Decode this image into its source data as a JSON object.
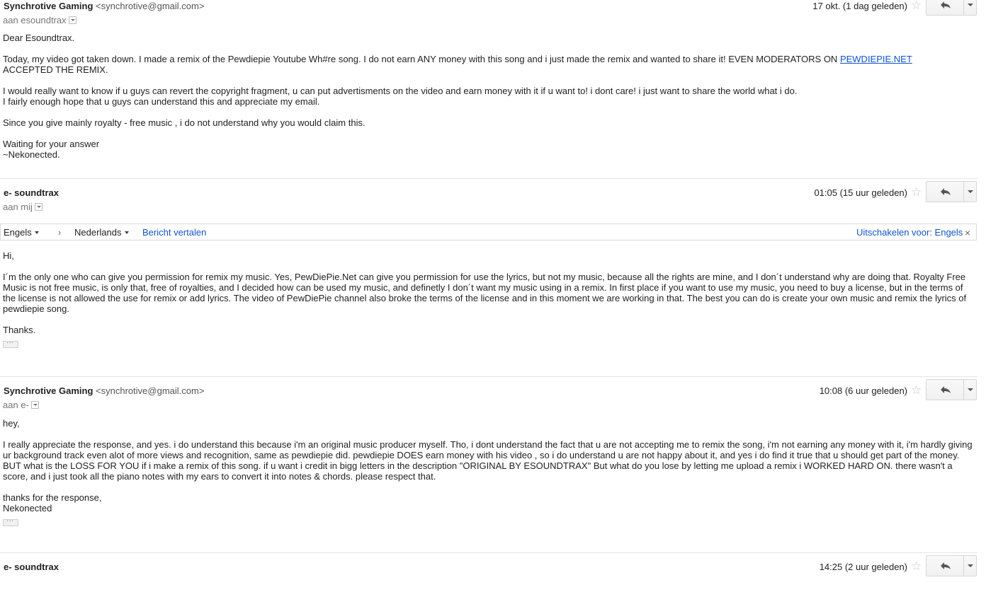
{
  "messages": [
    {
      "sender_name": "Synchrotive Gaming",
      "sender_email": "<synchrotive@gmail.com>",
      "to": "aan esoundtrax",
      "date": "17 okt. (1 dag geleden)",
      "paragraphs": [
        [
          "Dear Esoundtrax."
        ],
        [
          "Today, my video got taken down. I made a remix of the Pewdiepie Youtube Wh#re song. I do not earn ANY money with this song and i just made the remix and wanted to share it! EVEN MODERATORS ON "
        ],
        [
          "I would really want to know if u guys can revert the copyright fragment, u can put advertisments on the video and earn money with it if u want to! i dont care! i just want to share the world what i do.",
          "I fairly enough hope that u guys can understand this and appreciate my email."
        ],
        [
          "Since you give mainly royalty - free music , i do not understand why you would claim this."
        ],
        [
          "Waiting for your answer",
          "~Nekonected."
        ]
      ],
      "link_text": "PEWDIEPIE.NET",
      "after_link": "ACCEPTED THE REMIX."
    },
    {
      "sender_name": "e- soundtrax",
      "to": "aan mij",
      "date": "01:05 (15 uur geleden)",
      "paragraphs": [
        [
          "Hi,"
        ],
        [
          "I´m the only one who can give you permission for remix my music. Yes, PewDiePie.Net can give you permission for use the lyrics, but not my music, because all the rights are mine, and I don´t understand why are doing that. Royalty Free Music is not free music, is only that, free of royalties,  and I decided how can be used my music, and definetly I don´t want my music using in a remix. In first place if you want to use my music, you need to buy a license, but in the terms of the license is not allowed the use for remix or add lyrics. The video of PewDiePie channel also broke the terms of the license and in this moment we are working in that. The best you can do is create your own music and remix the lyrics of pewdiepie song."
        ],
        [
          "Thanks."
        ]
      ]
    },
    {
      "sender_name": "Synchrotive Gaming",
      "sender_email": "<synchrotive@gmail.com>",
      "to": "aan e-",
      "date": "10:08 (6 uur geleden)",
      "paragraphs": [
        [
          "hey,"
        ],
        [
          "I really appreciate the response, and yes. i do understand this because i'm an original music producer myself. Tho, i dont understand the fact that u are not accepting me to remix the song, i'm not earning any money with it, i'm hardly giving ur background track even alot of more views and recognition, same as pewdiepie did. pewdiepie DOES earn money with his video , so i do understand u are not happy about it, and yes i do find it true that u should get part of the money. BUT what is the LOSS FOR YOU if i make a remix of this song. if u want i credit in bigg letters in the description \"ORIGINAL BY ESOUNDTRAX\" But what do you lose by letting me upload a remix i WORKED HARD ON. there wasn't a score, and i just took all the piano notes with my ears to convert it into notes & chords. please respect that."
        ],
        [
          "thanks for the response,",
          "Nekonected"
        ]
      ]
    },
    {
      "sender_name": "e- soundtrax",
      "date": "14:25 (2 uur geleden)"
    }
  ],
  "translation_bar": {
    "from_lang": "Engels",
    "to_lang": "Nederlands",
    "translate_link": "Bericht vertalen",
    "disable_link": "Uitschakelen voor: Engels",
    "close_glyph": "×",
    "arrow_glyph": "›"
  },
  "icons": {
    "star": "☆",
    "reply": "reply-arrow-icon",
    "more": "chevron-down-icon"
  },
  "colors": {
    "link": "#1155cc",
    "border": "#e5e5e5",
    "star": "#c8c8c8"
  }
}
